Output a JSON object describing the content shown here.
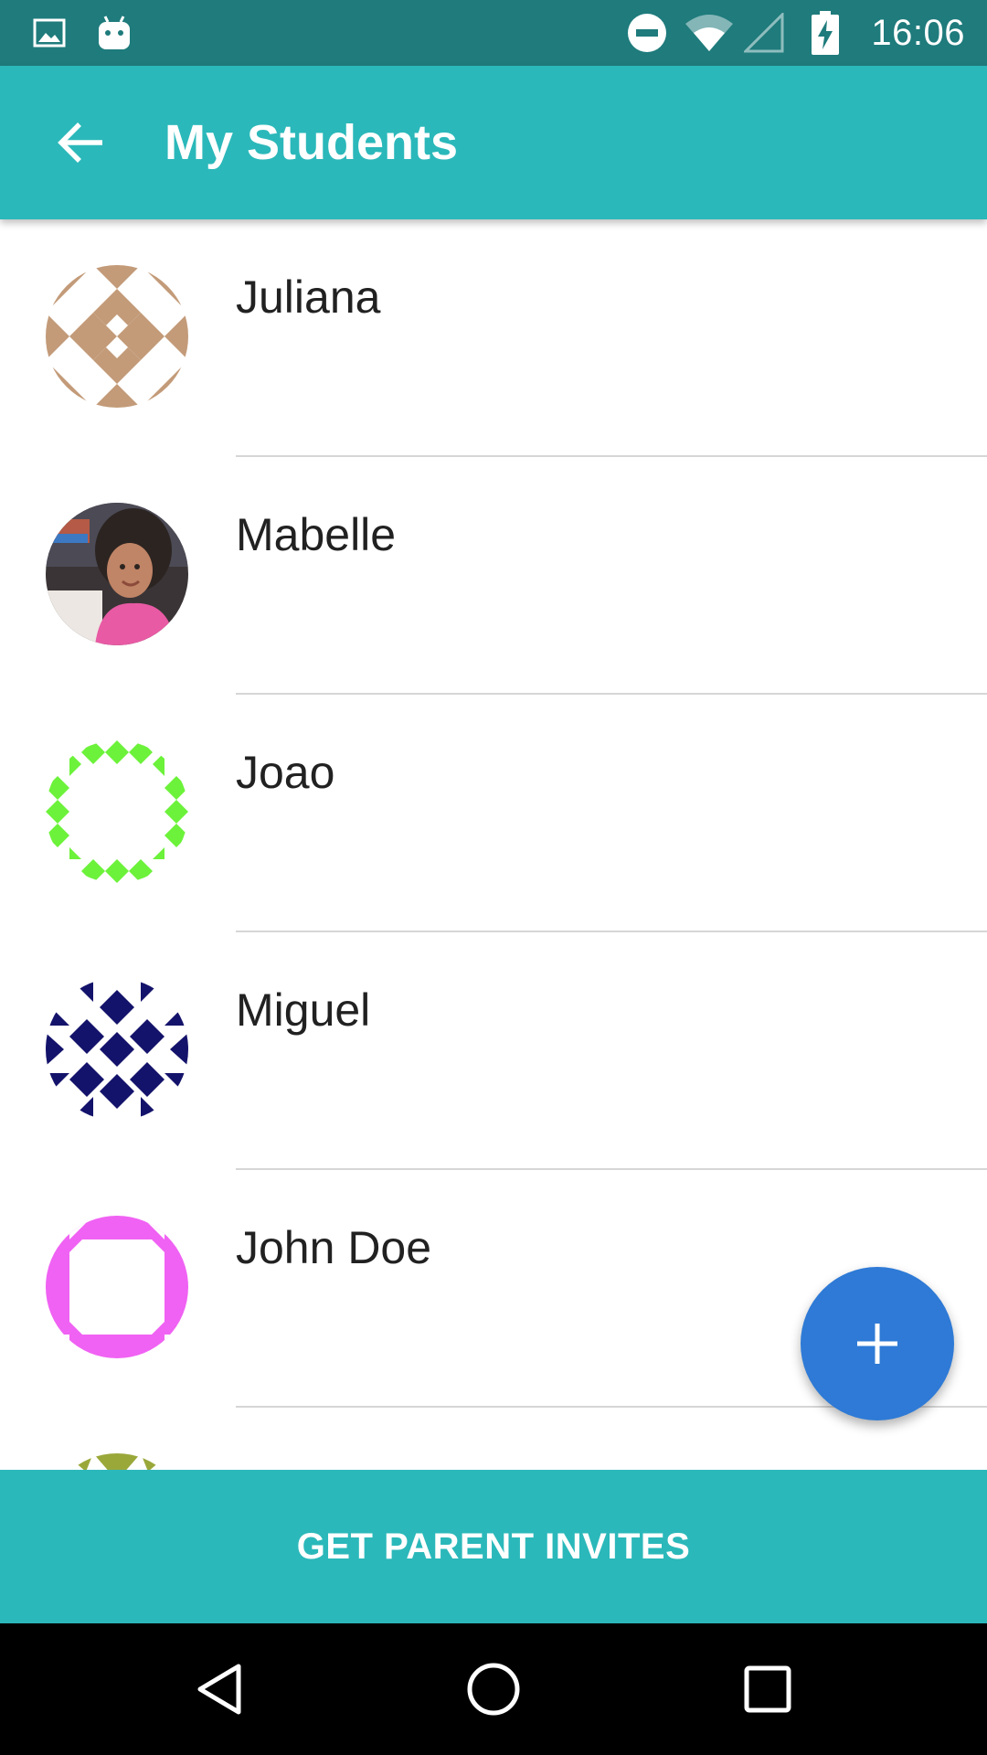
{
  "status_bar": {
    "time": "16:06",
    "icons": [
      "image-notification-icon",
      "android-debug-icon",
      "do-not-disturb-icon",
      "wifi-icon",
      "cell-signal-icon",
      "battery-charging-icon"
    ]
  },
  "app_bar": {
    "title": "My Students",
    "back_icon": "arrow-back-icon"
  },
  "students": [
    {
      "name": "Juliana",
      "avatar_color": "#c39b79"
    },
    {
      "name": "Mabelle",
      "avatar_color": "photo"
    },
    {
      "name": "Joao",
      "avatar_color": "#6cf23a"
    },
    {
      "name": "Miguel",
      "avatar_color": "#14136b"
    },
    {
      "name": "John Doe",
      "avatar_color": "#f062f3"
    },
    {
      "name": "",
      "avatar_color": "#9aa83a"
    }
  ],
  "fab": {
    "icon": "plus-icon"
  },
  "bottom_action": {
    "label": "GET PARENT INVITES"
  },
  "nav_bar": {
    "icons": [
      "back-triangle-icon",
      "home-circle-icon",
      "recents-square-icon"
    ]
  },
  "colors": {
    "status_bar": "#1f7b7c",
    "primary": "#2bb8ba",
    "fab": "#2e7ad6"
  }
}
